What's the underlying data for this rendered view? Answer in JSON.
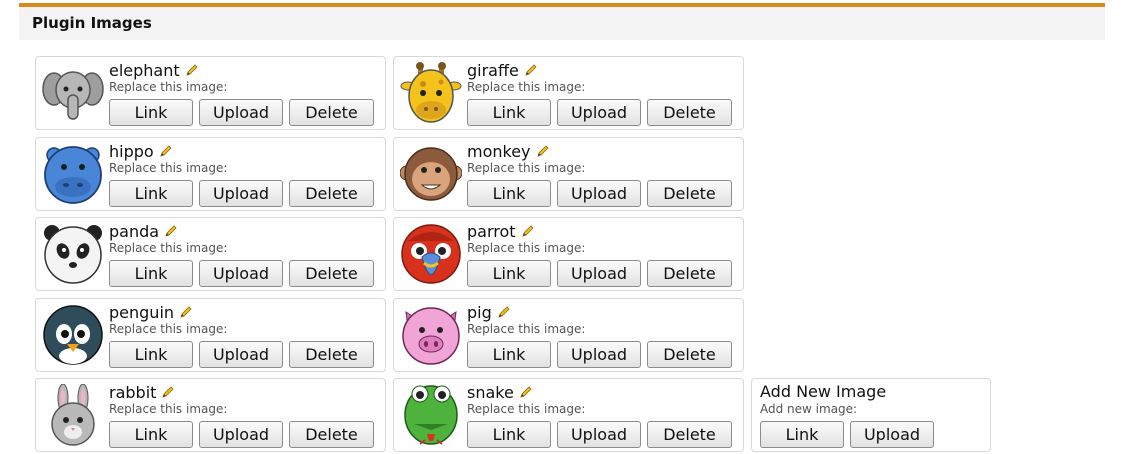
{
  "panel": {
    "title": "Plugin Images"
  },
  "common": {
    "replace_label": "Replace this image:",
    "link_label": "Link",
    "upload_label": "Upload",
    "delete_label": "Delete"
  },
  "images": [
    {
      "name": "elephant",
      "icon": "elephant-icon",
      "color": "#b7b7b7"
    },
    {
      "name": "giraffe",
      "icon": "giraffe-icon",
      "color": "#f3c21b"
    },
    {
      "name": "hippo",
      "icon": "hippo-icon",
      "color": "#4a86d8"
    },
    {
      "name": "monkey",
      "icon": "monkey-icon",
      "color": "#8c5a3c"
    },
    {
      "name": "panda",
      "icon": "panda-icon",
      "color": "#f4f4f4"
    },
    {
      "name": "parrot",
      "icon": "parrot-icon",
      "color": "#d8321e"
    },
    {
      "name": "penguin",
      "icon": "penguin-icon",
      "color": "#2e4c5a"
    },
    {
      "name": "pig",
      "icon": "pig-icon",
      "color": "#f1a5d6"
    },
    {
      "name": "rabbit",
      "icon": "rabbit-icon",
      "color": "#b9b9b9"
    },
    {
      "name": "snake",
      "icon": "snake-icon",
      "color": "#4db33d"
    }
  ],
  "add_new": {
    "title": "Add New Image",
    "sub": "Add new image:",
    "link_label": "Link",
    "upload_label": "Upload"
  },
  "colors": {
    "accent": "#d98a1c",
    "header_bg": "#f3f3f3"
  }
}
